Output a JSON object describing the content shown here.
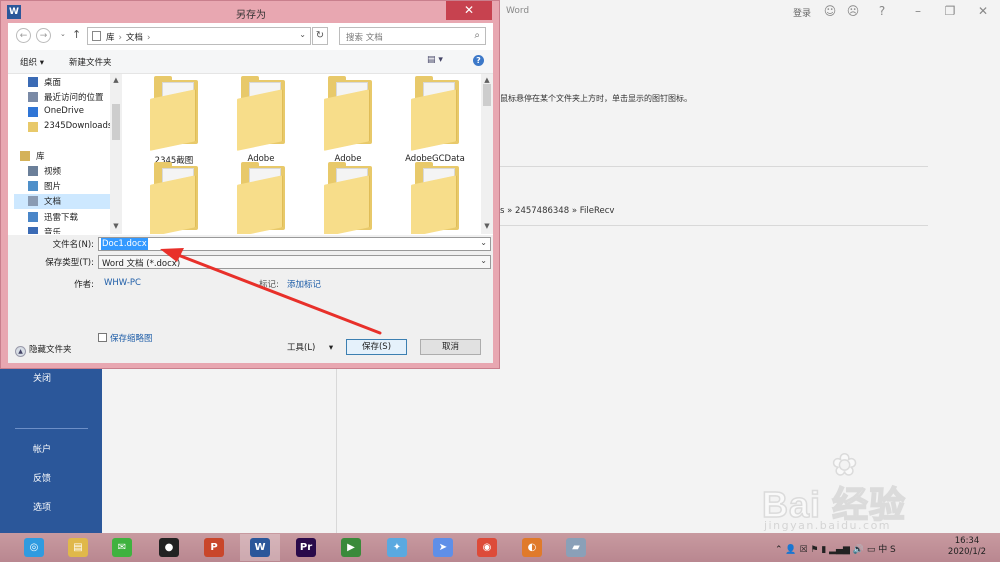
{
  "word": {
    "title": "Word",
    "signin": "登录",
    "title_icons": [
      "smile-icon",
      "frown-icon",
      "help-icon",
      "minimize-icon",
      "restore-icon",
      "close-icon"
    ],
    "title_icon_glyphs": [
      "☺",
      "☹",
      "?",
      "–",
      "❐",
      "✕"
    ],
    "left_nav": {
      "close": "关闭",
      "account": "帐户",
      "feedback": "反馈",
      "options": "选项"
    },
    "tip_text": "鼠标悬停在某个文件夹上方时，单击显示的图钉图标。",
    "path_text": "s » 2457486348 » FileRecv"
  },
  "dialog": {
    "title": "另存为",
    "app_icon_letter": "W",
    "close_glyph": "✕",
    "nav_back": "←",
    "nav_forward": "→",
    "recent_glyph": "⌄",
    "up_glyph": "↑",
    "breadcrumbs": [
      "库",
      "文档"
    ],
    "breadcrumb_sep": "›",
    "refresh_glyph": "↻",
    "search_placeholder": "搜索 文档",
    "search_glyph": "⌕",
    "toolbar": {
      "organize": "组织 ▾",
      "new_folder": "新建文件夹",
      "view": "▤ ▾",
      "help": "?"
    },
    "nav_items": [
      {
        "label": "桌面",
        "icon": "desktop-icon",
        "color": "#3b6bb5"
      },
      {
        "label": "最近访问的位置",
        "icon": "recent-places-icon",
        "color": "#7a8aa6"
      },
      {
        "label": "OneDrive",
        "icon": "onedrive-icon",
        "color": "#2f75d6"
      },
      {
        "label": "2345Downloads",
        "icon": "folder-icon",
        "color": "#e8c96a"
      },
      {
        "label": "库",
        "icon": "libraries-icon",
        "color": "#d4b25a"
      },
      {
        "label": "视频",
        "icon": "videos-icon",
        "color": "#6b7f99"
      },
      {
        "label": "图片",
        "icon": "pictures-icon",
        "color": "#4e8fc9"
      },
      {
        "label": "文档",
        "icon": "documents-icon",
        "color": "#8a9bb3"
      },
      {
        "label": "迅雷下载",
        "icon": "download-folder-icon",
        "color": "#4a86c8"
      },
      {
        "label": "音乐",
        "icon": "music-icon",
        "color": "#3b6bb5"
      }
    ],
    "folders": [
      "2345截图",
      "Adobe",
      "Adobe",
      "AdobeGCData",
      "",
      "",
      "",
      ""
    ],
    "fields": {
      "filename_label": "文件名(N):",
      "filename_value": "Doc1.docx",
      "filetype_label": "保存类型(T):",
      "filetype_value": "Word 文档 (*.docx)",
      "author_label": "作者:",
      "author_value": "WHW-PC",
      "tags_label": "标记:",
      "tags_value": "添加标记",
      "thumbnail_label": "保存缩略图"
    },
    "dropdown_glyph": "⌄",
    "hide_folders": "隐藏文件夹",
    "hide_glyph": "▲",
    "tools_label": "工具(L)",
    "tools_caret": "▾",
    "save_label": "保存(S)",
    "cancel_label": "取消"
  },
  "taskbar": {
    "apps": [
      {
        "name": "360-browser-icon",
        "glyph": "◎",
        "color": "#2f9be0"
      },
      {
        "name": "file-explorer-icon",
        "glyph": "▤",
        "color": "#e0b84a"
      },
      {
        "name": "wechat-icon",
        "glyph": "✉",
        "color": "#3fb23f"
      },
      {
        "name": "qq-icon",
        "glyph": "●",
        "color": "#222222"
      },
      {
        "name": "powerpoint-icon",
        "glyph": "P",
        "color": "#c9462b"
      },
      {
        "name": "word-icon",
        "glyph": "W",
        "color": "#2b579a"
      },
      {
        "name": "premiere-icon",
        "glyph": "Pr",
        "color": "#2a0a4a"
      },
      {
        "name": "media-player-icon",
        "glyph": "▶",
        "color": "#3a8a3a"
      },
      {
        "name": "bird-app-icon",
        "glyph": "✦",
        "color": "#5aa9e0"
      },
      {
        "name": "send-app-icon",
        "glyph": "➤",
        "color": "#5f8fe8"
      },
      {
        "name": "chrome-icon",
        "glyph": "◉",
        "color": "#dd4b39"
      },
      {
        "name": "app-orange-icon",
        "glyph": "◐",
        "color": "#e07a2a"
      },
      {
        "name": "app-book-icon",
        "glyph": "▰",
        "color": "#8aa0b8"
      }
    ],
    "tray": "⌃ 👤 ☒ ⚑ ▮ ▂▄▆ 🔊 ▭ 中 S",
    "time": "16:34",
    "date": "2020/1/2"
  },
  "watermark": {
    "text": "Bai  经验",
    "url": "jingyan.baidu.com"
  }
}
